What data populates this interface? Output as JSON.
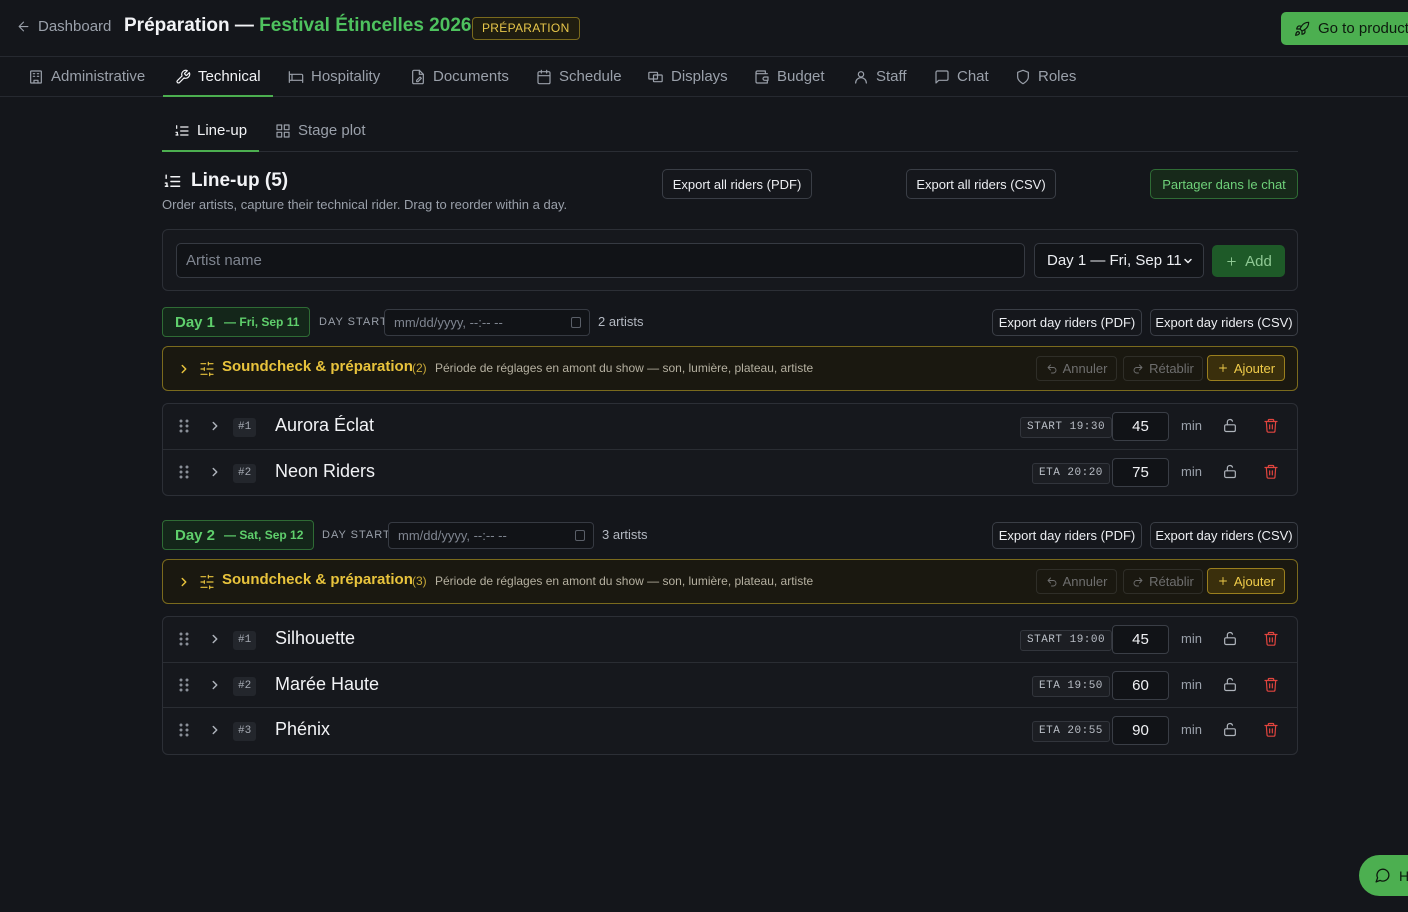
{
  "header": {
    "back_label": "Dashboard",
    "title_prefix": "Préparation — ",
    "festival_name": "Festival Étincelles 2026",
    "phase_badge": "PRÉPARATION",
    "go_button": "Go to product",
    "accent_color": "#4caf50"
  },
  "tabs": [
    {
      "label": "Administrative",
      "icon": "building-icon"
    },
    {
      "label": "Technical",
      "icon": "wrench-icon",
      "active": true
    },
    {
      "label": "Hospitality",
      "icon": "bed-icon"
    },
    {
      "label": "Documents",
      "icon": "document-edit-icon"
    },
    {
      "label": "Schedule",
      "icon": "calendar-icon"
    },
    {
      "label": "Displays",
      "icon": "displays-icon"
    },
    {
      "label": "Budget",
      "icon": "wallet-icon"
    },
    {
      "label": "Staff",
      "icon": "user-icon"
    },
    {
      "label": "Chat",
      "icon": "chat-icon"
    },
    {
      "label": "Roles",
      "icon": "shield-icon"
    }
  ],
  "subtabs": [
    {
      "label": "Line-up",
      "icon": "list-ordered-icon",
      "active": true
    },
    {
      "label": "Stage plot",
      "icon": "grid-icon"
    }
  ],
  "lineup": {
    "title": "Line-up (5)",
    "description": "Order artists, capture their technical rider. Drag to reorder within a day.",
    "export_pdf": "Export all riders (PDF)",
    "export_csv": "Export all riders (CSV)",
    "share_chat": "Partager dans le chat"
  },
  "add_form": {
    "artist_placeholder": "Artist name",
    "day_selected": "Day 1 — Fri, Sep 11",
    "add_label": "Add"
  },
  "days": [
    {
      "name": "Day 1",
      "date": "— Fri, Sep 11",
      "start_label": "DAY START",
      "start_placeholder": "mm/dd/yyyy, --:-- --",
      "artist_count": "2 artists",
      "export_pdf": "Export day riders (PDF)",
      "export_csv": "Export day riders (CSV)",
      "soundcheck": {
        "title": "Soundcheck & préparation",
        "count": "(2)",
        "description": "Période de réglages en amont du show — son, lumière, plateau, artiste",
        "undo": "Annuler",
        "redo": "Rétablir",
        "add": "Ajouter"
      },
      "artists": [
        {
          "num": "#1",
          "name": "Aurora Éclat",
          "time": "START 19:30",
          "duration": "45",
          "unit": "min"
        },
        {
          "num": "#2",
          "name": "Neon Riders",
          "time": "ETA 20:20",
          "duration": "75",
          "unit": "min"
        }
      ]
    },
    {
      "name": "Day 2",
      "date": "— Sat, Sep 12",
      "start_label": "DAY START",
      "start_placeholder": "mm/dd/yyyy, --:-- --",
      "artist_count": "3 artists",
      "export_pdf": "Export day riders (PDF)",
      "export_csv": "Export day riders (CSV)",
      "soundcheck": {
        "title": "Soundcheck & préparation",
        "count": "(3)",
        "description": "Période de réglages en amont du show — son, lumière, plateau, artiste",
        "undo": "Annuler",
        "redo": "Rétablir",
        "add": "Ajouter"
      },
      "artists": [
        {
          "num": "#1",
          "name": "Silhouette",
          "time": "START 19:00",
          "duration": "45",
          "unit": "min"
        },
        {
          "num": "#2",
          "name": "Marée Haute",
          "time": "ETA 19:50",
          "duration": "60",
          "unit": "min"
        },
        {
          "num": "#3",
          "name": "Phénix",
          "time": "ETA 20:55",
          "duration": "90",
          "unit": "min"
        }
      ]
    }
  ],
  "help_button": "H"
}
